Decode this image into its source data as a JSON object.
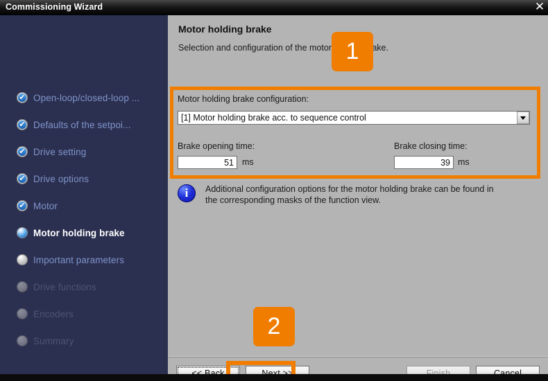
{
  "window": {
    "title": "Commissioning Wizard",
    "close_label": "✕",
    "close_icon": "close-icon"
  },
  "sidebar": {
    "items": [
      {
        "label": "Open-loop/closed-loop ...",
        "state": "done",
        "icon": "check-circle-icon"
      },
      {
        "label": "Defaults of the setpoi...",
        "state": "done",
        "icon": "check-circle-icon"
      },
      {
        "label": "Drive setting",
        "state": "done",
        "icon": "check-circle-icon"
      },
      {
        "label": "Drive options",
        "state": "done",
        "icon": "check-circle-icon"
      },
      {
        "label": "Motor",
        "state": "done",
        "icon": "check-circle-icon"
      },
      {
        "label": "Motor holding brake",
        "state": "current",
        "icon": "active-circle-icon"
      },
      {
        "label": "Important parameters",
        "state": "pending",
        "icon": "pending-circle-icon"
      },
      {
        "label": "Drive functions",
        "state": "disabled",
        "icon": "disabled-circle-icon"
      },
      {
        "label": "Encoders",
        "state": "disabled",
        "icon": "disabled-circle-icon"
      },
      {
        "label": "Summary",
        "state": "disabled",
        "icon": "disabled-circle-icon"
      }
    ]
  },
  "main": {
    "title": "Motor holding brake",
    "subtitle": "Selection and configuration of the motor holding brake.",
    "config": {
      "group_label": "Motor holding brake configuration:",
      "selected_option": "[1] Motor holding brake acc. to sequence control",
      "dropdown_icon": "chevron-down-icon",
      "opening_time_label": "Brake opening time:",
      "opening_time_value": "51",
      "opening_time_unit": "ms",
      "closing_time_label": "Brake closing time:",
      "closing_time_value": "39",
      "closing_time_unit": "ms"
    },
    "info": {
      "icon": "info-icon",
      "text": "Additional configuration options for the motor holding brake can be found in the corresponding masks of the function view."
    }
  },
  "footer": {
    "back_label": "<< Back",
    "next_label": "Next >>",
    "finish_label": "Finish",
    "cancel_label": "Cancel"
  },
  "annotations": {
    "badge_one": "1",
    "badge_two": "2",
    "highlight_color": "#f07d00"
  },
  "colors": {
    "sidebar_bg": "#2b3051",
    "content_bg": "#b4b4b4",
    "accent_orange": "#f07d00",
    "nav_link": "#7f93c8",
    "nav_disabled": "#4d5470",
    "titlebar_text": "#ffffff"
  }
}
